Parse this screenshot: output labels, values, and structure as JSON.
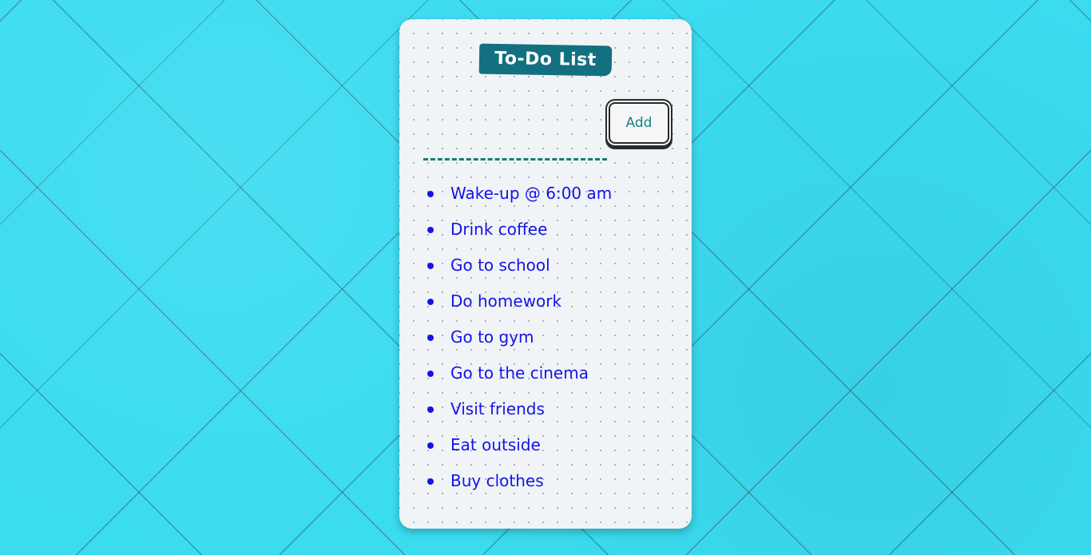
{
  "app": {
    "title": "To-Do List"
  },
  "form": {
    "input_value": "",
    "input_placeholder": "",
    "add_label": "Add"
  },
  "todos": [
    "Wake-up @ 6:00 am",
    "Drink coffee",
    "Go to school",
    "Do homework",
    "Go to gym",
    "Go to the cinema",
    "Visit friends",
    "Eat outside",
    "Buy clothes"
  ],
  "colors": {
    "background": "#3bdbf0",
    "card": "#f1f4f7",
    "title_badge": "#137080",
    "input_underline": "#117c78",
    "add_text": "#1a7f86",
    "todo_text": "#1414e6"
  }
}
